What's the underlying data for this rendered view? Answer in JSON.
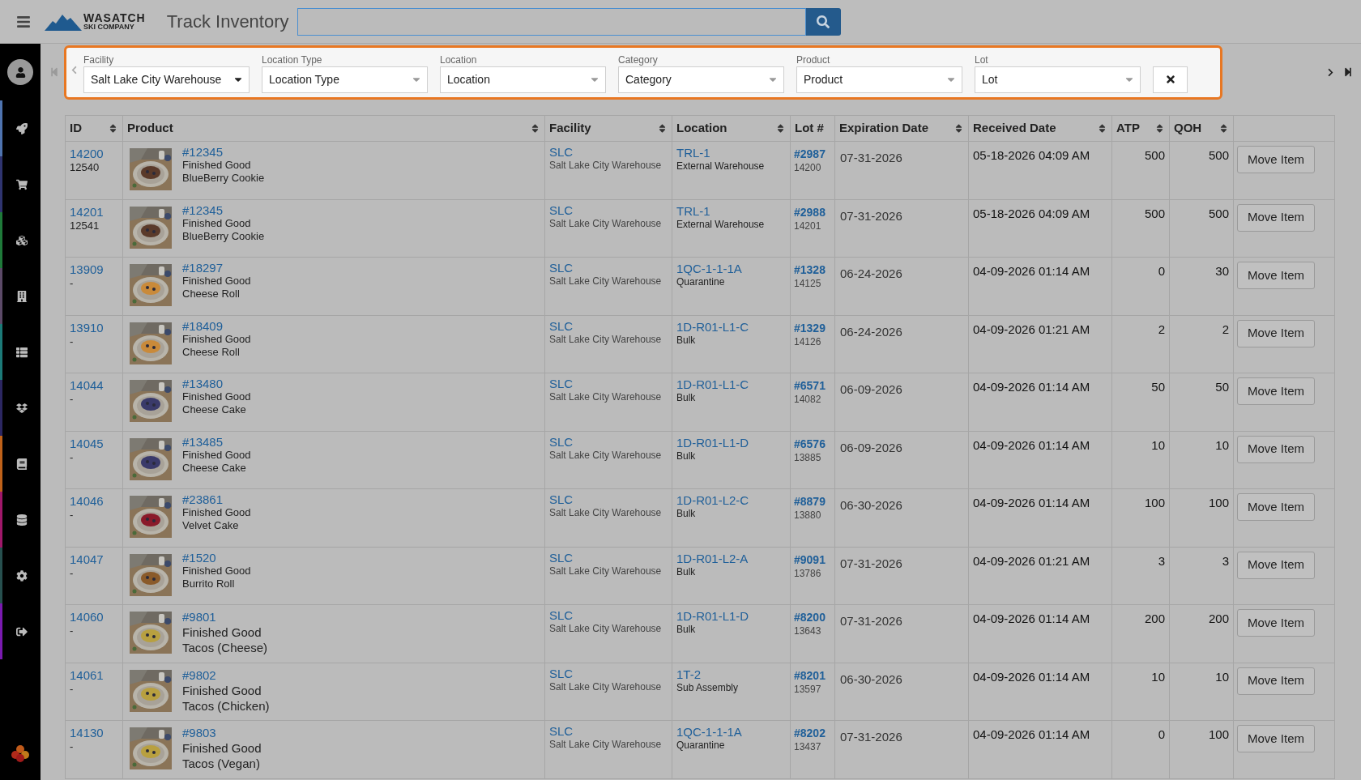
{
  "header": {
    "logo_top": "WASATCH",
    "logo_bottom": "SKI COMPANY",
    "title": "Track Inventory"
  },
  "sidebar": {
    "items": [
      {
        "color": "#4f74b0"
      },
      {
        "color": "#2f3470"
      },
      {
        "color": "#1f7a3a"
      },
      {
        "color": "#5c4a68"
      },
      {
        "color": "#1c7a78"
      },
      {
        "color": "#2c2762"
      },
      {
        "color": "#c0621a"
      },
      {
        "color": "#a0186a"
      },
      {
        "color": "#27504f"
      },
      {
        "color": "#7a1ab0"
      }
    ]
  },
  "filters": [
    {
      "label": "Facility",
      "value": "Salt Lake City Warehouse"
    },
    {
      "label": "Location Type",
      "placeholder": "Location Type"
    },
    {
      "label": "Location",
      "placeholder": "Location"
    },
    {
      "label": "Category",
      "placeholder": "Category"
    },
    {
      "label": "Product",
      "placeholder": "Product"
    },
    {
      "label": "Lot",
      "placeholder": "Lot"
    }
  ],
  "pagination": {
    "first_disabled": true,
    "prev_disabled": true
  },
  "table": {
    "columns": [
      {
        "label": "ID",
        "sortable": true
      },
      {
        "label": "Product",
        "sortable": true
      },
      {
        "label": "Facility",
        "sortable": true
      },
      {
        "label": "Location",
        "sortable": true
      },
      {
        "label": "Lot #",
        "sortable": false
      },
      {
        "label": "Expiration Date",
        "sortable": true
      },
      {
        "label": "Received Date",
        "sortable": true
      },
      {
        "label": "ATP",
        "sortable": true
      },
      {
        "label": "QOH",
        "sortable": true
      }
    ],
    "rows": [
      {
        "kind": "compact",
        "id": "14200",
        "sub_id": "12540",
        "sku": "#12345",
        "type": "Finished Good",
        "name": "BlueBerry Cookie",
        "facility_code": "SLC",
        "facility_name": "Salt Lake City Warehouse",
        "location": "TRL-1",
        "location_type": "External Warehouse",
        "lot": "#2987",
        "lot_id": "14200",
        "expiration": "07-31-2026",
        "received": "05-18-2026 04:09 AM",
        "atp": "500",
        "qoh": "500",
        "action": "Move Item"
      },
      {
        "kind": "compact",
        "id": "14201",
        "sub_id": "12541",
        "sku": "#12345",
        "type": "Finished Good",
        "name": "BlueBerry Cookie",
        "facility_code": "SLC",
        "facility_name": "Salt Lake City Warehouse",
        "location": "TRL-1",
        "location_type": "External Warehouse",
        "lot": "#2988",
        "lot_id": "14201",
        "expiration": "07-31-2026",
        "received": "05-18-2026 04:09 AM",
        "atp": "500",
        "qoh": "500",
        "action": "Move Item"
      },
      {
        "kind": "compact",
        "id": "13909",
        "sub_id": "-",
        "sku": "#18297",
        "type": "Finished Good",
        "name": "Cheese Roll",
        "facility_code": "SLC",
        "facility_name": "Salt Lake City Warehouse",
        "location": "1QC-1-1-1A",
        "location_type": "Quarantine",
        "lot": "#1328",
        "lot_id": "14125",
        "expiration": "06-24-2026",
        "received": "04-09-2026 01:14 AM",
        "atp": "0",
        "qoh": "30",
        "action": "Move Item"
      },
      {
        "kind": "compact",
        "id": "13910",
        "sub_id": "-",
        "sku": "#18409",
        "type": "Finished Good",
        "name": "Cheese Roll",
        "facility_code": "SLC",
        "facility_name": "Salt Lake City Warehouse",
        "location": "1D-R01-L1-C",
        "location_type": "Bulk",
        "lot": "#1329",
        "lot_id": "14126",
        "expiration": "06-24-2026",
        "received": "04-09-2026 01:21 AM",
        "atp": "2",
        "qoh": "2",
        "action": "Move Item"
      },
      {
        "kind": "compact",
        "id": "14044",
        "sub_id": "-",
        "sku": "#13480",
        "type": "Finished Good",
        "name": "Cheese Cake",
        "facility_code": "SLC",
        "facility_name": "Salt Lake City Warehouse",
        "location": "1D-R01-L1-C",
        "location_type": "Bulk",
        "lot": "#6571",
        "lot_id": "14082",
        "expiration": "06-09-2026",
        "received": "04-09-2026 01:14 AM",
        "atp": "50",
        "qoh": "50",
        "action": "Move Item"
      },
      {
        "kind": "compact",
        "id": "14045",
        "sub_id": "-",
        "sku": "#13485",
        "type": "Finished Good",
        "name": "Cheese Cake",
        "facility_code": "SLC",
        "facility_name": "Salt Lake City Warehouse",
        "location": "1D-R01-L1-D",
        "location_type": "Bulk",
        "lot": "#6576",
        "lot_id": "13885",
        "expiration": "06-09-2026",
        "received": "04-09-2026 01:14 AM",
        "atp": "10",
        "qoh": "10",
        "action": "Move Item"
      },
      {
        "kind": "compact",
        "id": "14046",
        "sub_id": "-",
        "sku": "#23861",
        "type": "Finished Good",
        "name": "Velvet Cake",
        "facility_code": "SLC",
        "facility_name": "Salt Lake City Warehouse",
        "location": "1D-R01-L2-C",
        "location_type": "Bulk",
        "lot": "#8879",
        "lot_id": "13880",
        "expiration": "06-30-2026",
        "received": "04-09-2026 01:14 AM",
        "atp": "100",
        "qoh": "100",
        "action": "Move Item"
      },
      {
        "kind": "compact",
        "id": "14047",
        "sub_id": "-",
        "sku": "#1520",
        "type": "Finished Good",
        "name": "Burrito Roll",
        "facility_code": "SLC",
        "facility_name": "Salt Lake City Warehouse",
        "location": "1D-R01-L2-A",
        "location_type": "Bulk",
        "lot": "#9091",
        "lot_id": "13786",
        "expiration": "07-31-2026",
        "received": "04-09-2026 01:21 AM",
        "atp": "3",
        "qoh": "3",
        "action": "Move Item"
      },
      {
        "kind": "large",
        "id": "14060",
        "sub_id": "-",
        "sku": "#9801",
        "type": "Finished Good",
        "name": "Tacos (Cheese)",
        "facility_code": "SLC",
        "facility_name": "Salt Lake City Warehouse",
        "location": "1D-R01-L1-D",
        "location_type": "Bulk",
        "lot": "#8200",
        "lot_id": "13643",
        "expiration": "07-31-2026",
        "received": "04-09-2026 01:14 AM",
        "atp": "200",
        "qoh": "200",
        "action": "Move Item"
      },
      {
        "kind": "large",
        "id": "14061",
        "sub_id": "-",
        "sku": "#9802",
        "type": "Finished Good",
        "name": "Tacos (Chicken)",
        "facility_code": "SLC",
        "facility_name": "Salt Lake City Warehouse",
        "location": "1T-2",
        "location_type": "Sub Assembly",
        "lot": "#8201",
        "lot_id": "13597",
        "expiration": "06-30-2026",
        "received": "04-09-2026 01:14 AM",
        "atp": "10",
        "qoh": "10",
        "action": "Move Item"
      },
      {
        "kind": "large",
        "id": "14130",
        "sub_id": "-",
        "sku": "#9803",
        "type": "Finished Good",
        "name": "Tacos (Vegan)",
        "facility_code": "SLC",
        "facility_name": "Salt Lake City Warehouse",
        "location": "1QC-1-1-1A",
        "location_type": "Quarantine",
        "lot": "#8202",
        "lot_id": "13437",
        "expiration": "07-31-2026",
        "received": "04-09-2026 01:14 AM",
        "atp": "0",
        "qoh": "100",
        "action": "Move Item"
      }
    ]
  }
}
